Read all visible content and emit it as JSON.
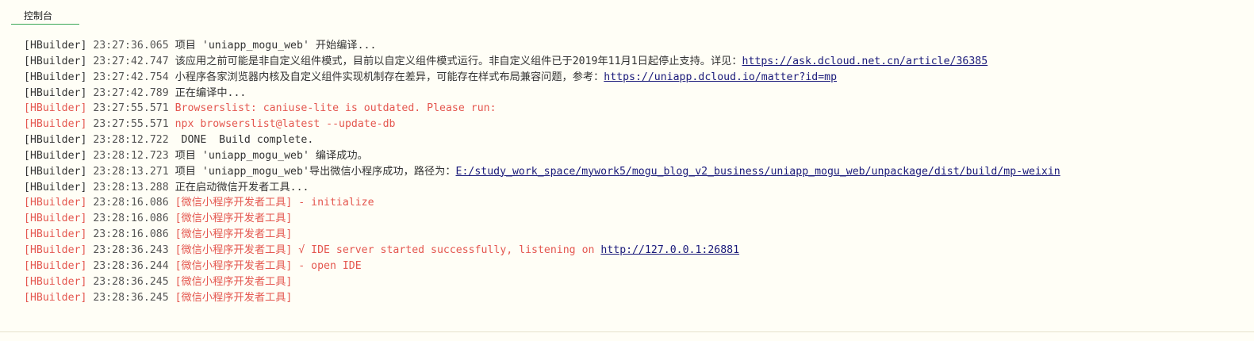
{
  "panel": {
    "tab_label": "控制台"
  },
  "console": {
    "lines": [
      {
        "tag": "[HBuilder]",
        "time": "23:27:36.065",
        "text": "项目 'uniapp_mogu_web' 开始编译...",
        "level": "info"
      },
      {
        "tag": "[HBuilder]",
        "time": "23:27:42.747",
        "text": "该应用之前可能是非自定义组件模式，目前以自定义组件模式运行。非自定义组件已于2019年11月1日起停止支持。详见：",
        "link": "https://ask.dcloud.net.cn/article/36385",
        "level": "info"
      },
      {
        "tag": "[HBuilder]",
        "time": "23:27:42.754",
        "text": "小程序各家浏览器内核及自定义组件实现机制存在差异，可能存在样式布局兼容问题，参考：",
        "link": "https://uniapp.dcloud.io/matter?id=mp",
        "level": "info"
      },
      {
        "tag": "[HBuilder]",
        "time": "23:27:42.789",
        "text": "正在编译中...",
        "level": "info"
      },
      {
        "tag": "[HBuilder]",
        "time": "23:27:55.571",
        "text": "Browserslist: caniuse-lite is outdated. Please run:",
        "level": "error"
      },
      {
        "tag": "[HBuilder]",
        "time": "23:27:55.571",
        "text": "npx browserslist@latest --update-db",
        "level": "error"
      },
      {
        "tag": "[HBuilder]",
        "time": "23:28:12.722",
        "text": " DONE  Build complete.",
        "level": "info"
      },
      {
        "tag": "[HBuilder]",
        "time": "23:28:12.723",
        "text": "项目 'uniapp_mogu_web' 编译成功。",
        "level": "info"
      },
      {
        "tag": "[HBuilder]",
        "time": "23:28:13.271",
        "text": "项目 'uniapp_mogu_web'导出微信小程序成功，路径为：",
        "link": "E:/study_work_space/mywork5/mogu_blog_v2_business/uniapp_mogu_web/unpackage/dist/build/mp-weixin",
        "level": "info"
      },
      {
        "tag": "[HBuilder]",
        "time": "23:28:13.288",
        "text": "正在启动微信开发者工具...",
        "level": "info"
      },
      {
        "tag": "[HBuilder]",
        "time": "23:28:16.086",
        "text": "[微信小程序开发者工具] - initialize",
        "level": "error"
      },
      {
        "tag": "[HBuilder]",
        "time": "23:28:16.086",
        "text": "[微信小程序开发者工具]",
        "level": "error"
      },
      {
        "tag": "[HBuilder]",
        "time": "23:28:16.086",
        "text": "[微信小程序开发者工具]",
        "level": "error"
      },
      {
        "tag": "[HBuilder]",
        "time": "23:28:36.243",
        "text": "[微信小程序开发者工具] √ IDE server started successfully, listening on ",
        "link": "http://127.0.0.1:26881",
        "level": "error"
      },
      {
        "tag": "[HBuilder]",
        "time": "23:28:36.244",
        "text": "[微信小程序开发者工具] - open IDE",
        "level": "error"
      },
      {
        "tag": "[HBuilder]",
        "time": "23:28:36.245",
        "text": "[微信小程序开发者工具]",
        "level": "error"
      },
      {
        "tag": "[HBuilder]",
        "time": "23:28:36.245",
        "text": "[微信小程序开发者工具]",
        "level": "error"
      }
    ]
  },
  "colors": {
    "background": "#fffef6",
    "info_text": "#333333",
    "error_text": "#e4574f",
    "link": "#1a1a7a",
    "tab_underline": "#3aa757"
  }
}
